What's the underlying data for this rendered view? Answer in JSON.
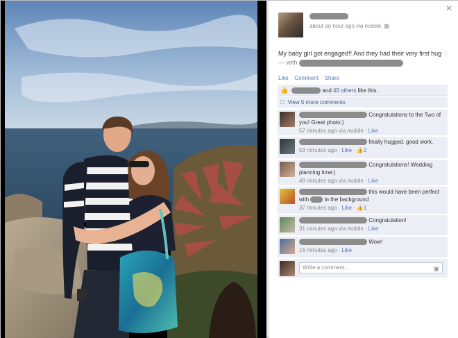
{
  "post": {
    "meta": "about an hour ago via mobile",
    "text_main": "My baby girl got engaged!! And they had their very first hug",
    "text_with": "— with",
    "actions": [
      "Like",
      "Comment",
      "Share"
    ]
  },
  "likes": {
    "middle": "and",
    "others": "40 others",
    "suffix": "like this."
  },
  "more_comments": "View 5 more comments",
  "comments": [
    {
      "text": "Congratulations to the Two of you! Great photo:)",
      "time": "57 minutes ago via mobile",
      "like": "Like",
      "likes_count": ""
    },
    {
      "text": "finally hugged. good work.",
      "time": "53 minutes ago",
      "like": "Like",
      "likes_count": "2"
    },
    {
      "text": "Congratulations! Wedding planning time:)",
      "time": "49 minutes ago via mobile",
      "like": "Like",
      "likes_count": ""
    },
    {
      "text_a": "this would have been perfect with",
      "text_b": "in the background",
      "time": "37 minutes ago",
      "like": "Like",
      "likes_count": "1"
    },
    {
      "text": "Congratulation!",
      "time": "31 minutes ago via mobile",
      "like": "Like",
      "likes_count": ""
    },
    {
      "text": "Wow!",
      "time": "16 minutes ago",
      "like": "Like",
      "likes_count": ""
    }
  ],
  "composer": {
    "placeholder": "Write a comment..."
  },
  "icons": [
    "close-icon",
    "mobile-icon",
    "heart-icon",
    "thumbs-up-icon",
    "comment-bubble-icon",
    "camera-icon"
  ]
}
